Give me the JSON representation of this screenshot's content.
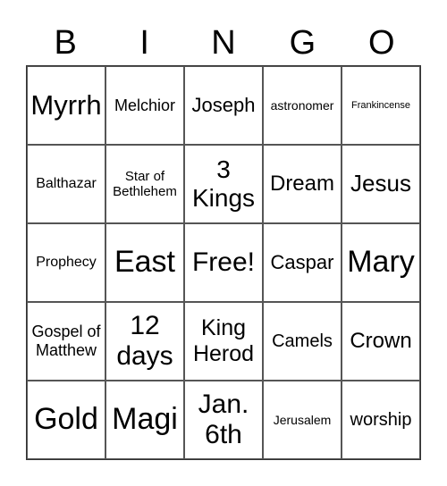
{
  "header": [
    "B",
    "I",
    "N",
    "G",
    "O"
  ],
  "cells": [
    "Myrrh",
    "Melchior",
    "Joseph",
    "astronomer",
    "Frankincense",
    "Balthazar",
    "Star of Bethlehem",
    "3 Kings",
    "Dream",
    "Jesus",
    "Prophecy",
    "East",
    "Free!",
    "Caspar",
    "Mary",
    "Gospel of Matthew",
    "12 days",
    "King Herod",
    "Camels",
    "Crown",
    "Gold",
    "Magi",
    "Jan. 6th",
    "Jerusalem",
    "worship"
  ]
}
